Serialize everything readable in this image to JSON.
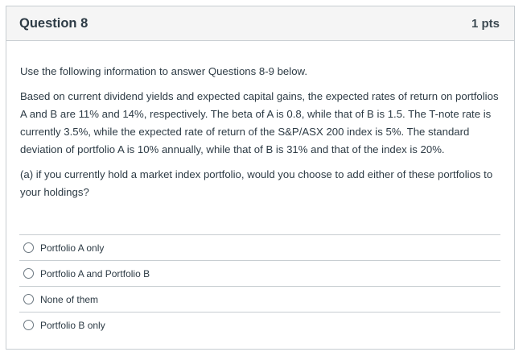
{
  "question": {
    "title": "Question 8",
    "points": "1 pts",
    "intro": "Use the following information to answer Questions 8-9 below.",
    "body": "Based on current dividend yields and expected capital gains, the expected rates of return on portfolios A and B are 11% and 14%, respectively. The beta of A is 0.8, while that of B is 1.5. The T-note rate is currently 3.5%, while the expected rate of return of the S&P/ASX 200 index is 5%. The standard deviation of portfolio A is 10% annually, while that of B is 31% and that of the index is 20%.",
    "prompt": "(a) if you currently hold a market index portfolio, would you choose to add either of these portfolios to your holdings?"
  },
  "answers": [
    {
      "label": "Portfolio A only",
      "selected": false
    },
    {
      "label": "Portfolio A and Portfolio B",
      "selected": false
    },
    {
      "label": "None of them",
      "selected": false
    },
    {
      "label": "Portfolio B only",
      "selected": false
    }
  ]
}
